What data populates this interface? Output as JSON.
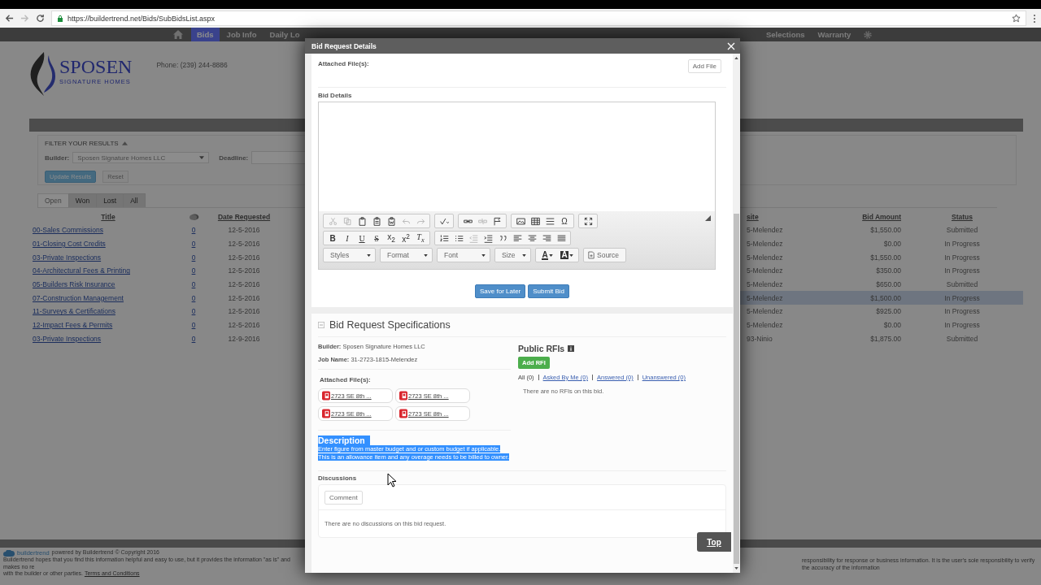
{
  "browser": {
    "url": "https://buildertrend.net/Bids/SubBidsList.aspx"
  },
  "nav": {
    "left": [
      {
        "label": "Bids",
        "selected": true
      },
      {
        "label": "Job Info",
        "selected": false
      },
      {
        "label": "Daily Lo",
        "selected": false
      }
    ],
    "right": [
      {
        "label": "Selections",
        "selected": false
      },
      {
        "label": "Warranty",
        "selected": false
      }
    ]
  },
  "company": {
    "name": "SPOSEN",
    "tagline": "SIGNATURE HOMES",
    "phone": "Phone: (239) 244-8886"
  },
  "filter": {
    "title": "FILTER YOUR RESULTS",
    "expanded": true,
    "builder_label": "Builder:",
    "builder_value": "Sposen Signature Homes LLC",
    "deadline_label": "Deadline:",
    "buttons": [
      "Update Results",
      "Reset"
    ]
  },
  "tabs": [
    {
      "label": "Open",
      "selected": true
    },
    {
      "label": "Won",
      "selected": false
    },
    {
      "label": "Lost",
      "selected": false
    },
    {
      "label": "All",
      "selected": false
    }
  ],
  "bids_table": {
    "left_columns": [
      "Title",
      "Date Requested"
    ],
    "right_columns": [
      "site",
      "Bid Amount",
      "Status"
    ],
    "rows": [
      {
        "title": "00-Sales Commissions",
        "comments": "0",
        "date": "12-5-2016",
        "jobsite": "5-Melendez",
        "amount": "$1,550.00",
        "status": "Submitted",
        "selected": false
      },
      {
        "title": "01-Closing Cost Credits",
        "comments": "0",
        "date": "12-5-2016",
        "jobsite": "5-Melendez",
        "amount": "$0.00",
        "status": "In Progress",
        "selected": false
      },
      {
        "title": "03-Private Inspections",
        "comments": "0",
        "date": "12-5-2016",
        "jobsite": "5-Melendez",
        "amount": "$1,550.00",
        "status": "In Progress",
        "selected": false
      },
      {
        "title": "04-Architectural Fees & Printing",
        "comments": "0",
        "date": "12-5-2016",
        "jobsite": "5-Melendez",
        "amount": "$350.00",
        "status": "In Progress",
        "selected": false
      },
      {
        "title": "05-Builders Risk Insurance",
        "comments": "0",
        "date": "12-5-2016",
        "jobsite": "5-Melendez",
        "amount": "$650.00",
        "status": "Submitted",
        "selected": false
      },
      {
        "title": "07-Construction Management",
        "comments": "0",
        "date": "12-5-2016",
        "jobsite": "5-Melendez",
        "amount": "$1,500.00",
        "status": "In Progress",
        "selected": true
      },
      {
        "title": "11-Surveys & Certifications",
        "comments": "0",
        "date": "12-5-2016",
        "jobsite": "5-Melendez",
        "amount": "$925.00",
        "status": "In Progress",
        "selected": false
      },
      {
        "title": "12-Impact Fees & Permits",
        "comments": "0",
        "date": "12-5-2016",
        "jobsite": "5-Melendez",
        "amount": "$0.00",
        "status": "In Progress",
        "selected": false
      },
      {
        "title": "03-Private Inspections",
        "comments": "0",
        "date": "12-9-2016",
        "jobsite": "93-Ninio",
        "amount": "$1,875.00",
        "status": "Submitted",
        "selected": false
      }
    ]
  },
  "footer": {
    "brand": "buildertrend",
    "powered": "powered by Buildertrend © Copyright 2016",
    "disclaimer_left": "Buildertrend hopes that you find this information helpful and easy to use, but it provides the information \"as is\" and makes no re",
    "disclaimer_line2": "with the builder or other parties.",
    "terms": "Terms and Conditions",
    "disclaimer_right": "responsibility for response or business information. It is the user's sole responsibility to verify the accuracy of the information"
  },
  "modal": {
    "title": "Bid Request Details",
    "attached_label": "Attached File(s):",
    "add_file": "Add File",
    "bid_details_label": "Bid Details",
    "toolbar": [
      [
        [
          {
            "kind": "cut",
            "disabled": true
          },
          {
            "kind": "copy",
            "disabled": true
          },
          {
            "kind": "paste",
            "disabled": false
          },
          {
            "kind": "pastetext",
            "disabled": false
          },
          {
            "kind": "pasteword",
            "disabled": false
          },
          {
            "kind": "undo",
            "disabled": true
          },
          {
            "kind": "redo",
            "disabled": true
          }
        ],
        [
          {
            "kind": "spell",
            "disabled": false
          }
        ],
        [
          {
            "kind": "link",
            "disabled": false
          },
          {
            "kind": "unlink",
            "disabled": true
          },
          {
            "kind": "anchor",
            "disabled": false
          }
        ],
        [
          {
            "kind": "image",
            "disabled": false
          },
          {
            "kind": "table",
            "disabled": false
          },
          {
            "kind": "hr",
            "disabled": false
          },
          {
            "kind": "symbol",
            "text": "Ω",
            "disabled": false
          }
        ],
        [
          {
            "kind": "maximize",
            "disabled": false
          }
        ]
      ],
      [
        [
          {
            "kind": "bold",
            "text": "B",
            "disabled": false
          },
          {
            "kind": "italic",
            "text": "I",
            "disabled": false
          },
          {
            "kind": "underline",
            "text": "U",
            "disabled": false
          },
          {
            "kind": "strike",
            "text": "S",
            "disabled": false
          },
          {
            "kind": "subscript",
            "text": "x$_{2}$",
            "disabled": false
          },
          {
            "kind": "superscript",
            "text": "x$^{2}$",
            "disabled": false
          },
          {
            "kind": "removeformat",
            "text": "T$_{x}$",
            "disabled": false
          }
        ],
        [
          {
            "kind": "numlist",
            "disabled": false
          },
          {
            "kind": "bullist",
            "disabled": false
          },
          {
            "kind": "outdent",
            "disabled": true
          },
          {
            "kind": "indent",
            "disabled": false
          },
          {
            "kind": "quote",
            "disabled": false
          },
          {
            "kind": "alignleft",
            "disabled": false
          },
          {
            "kind": "aligncenter",
            "disabled": false
          },
          {
            "kind": "alignright",
            "disabled": false
          },
          {
            "kind": "justify",
            "disabled": false
          }
        ]
      ],
      [
        [
          {
            "kind": "combo",
            "label": "Styles",
            "disabled": false
          }
        ],
        [
          {
            "kind": "combo",
            "label": "Format",
            "disabled": false
          }
        ],
        [
          {
            "kind": "combo",
            "label": "Font",
            "disabled": false
          }
        ],
        [
          {
            "kind": "combo",
            "label": "Size",
            "disabled": false
          }
        ],
        [
          {
            "kind": "textcolor",
            "text": "A",
            "disabled": false
          },
          {
            "kind": "bgcolor",
            "text": "A",
            "disabled": false
          }
        ],
        [
          {
            "kind": "source",
            "label": "Source",
            "disabled": false
          }
        ]
      ]
    ],
    "actions": [
      "Save for Later",
      "Submit Bid"
    ],
    "specs": {
      "title": "Bid Request Specifications",
      "expanded": true,
      "builder_label": "Builder:",
      "builder": "Sposen Signature Homes LLC",
      "job_label": "Job Name:",
      "job": "31-2723-1815-Melendez",
      "files_label": "Attached File(s):",
      "files": [
        "2723 SE 8th ...",
        "2723 SE 8th ...",
        "2723 SE 8th ...",
        "2723 SE 8th ..."
      ],
      "description": {
        "title": "Description",
        "selected": true,
        "lines": [
          "Enter figure from master budget and or custom budget if applicable.",
          "This is an allowance item and any overage needs to be billed to owner."
        ]
      },
      "rfi": {
        "title": "Public RFIs",
        "add": "Add RFI",
        "filters": [
          {
            "label": "All (0)",
            "selected": true
          },
          {
            "label": "Asked By Me (0)",
            "selected": false
          },
          {
            "label": "Answered (0)",
            "selected": false
          },
          {
            "label": "Unanswered (0)",
            "selected": false
          }
        ],
        "empty": "There are no RFIs on this bid."
      },
      "discussions": {
        "label": "Discussions",
        "comment": "Comment",
        "empty": "There are no discussions on this bid request."
      }
    },
    "top_button": "Top"
  }
}
